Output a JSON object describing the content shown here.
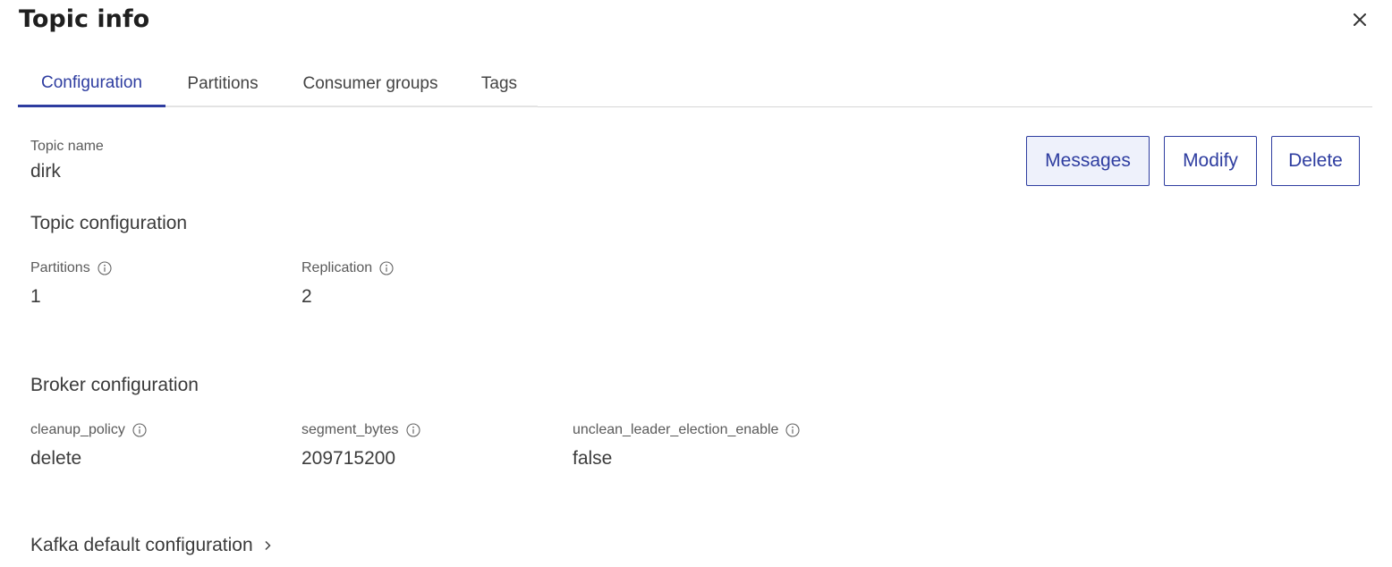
{
  "header": {
    "title": "Topic info"
  },
  "tabs": [
    {
      "label": "Configuration"
    },
    {
      "label": "Partitions"
    },
    {
      "label": "Consumer groups"
    },
    {
      "label": "Tags"
    }
  ],
  "topic": {
    "name_label": "Topic name",
    "name_value": "dirk"
  },
  "actions": {
    "messages": "Messages",
    "modify": "Modify",
    "delete": "Delete"
  },
  "topic_configuration": {
    "title": "Topic configuration",
    "fields": [
      {
        "label": "Partitions",
        "value": "1"
      },
      {
        "label": "Replication",
        "value": "2"
      }
    ]
  },
  "broker_configuration": {
    "title": "Broker configuration",
    "fields": [
      {
        "label": "cleanup_policy",
        "value": "delete"
      },
      {
        "label": "segment_bytes",
        "value": "209715200"
      },
      {
        "label": "unclean_leader_election_enable",
        "value": "false"
      }
    ]
  },
  "kafka_defaults": {
    "label": "Kafka default configuration"
  },
  "colors": {
    "accent": "#2e3da0",
    "primary_button_bg": "#eef1fb"
  },
  "icons": {
    "close": "close-icon",
    "info": "info-icon",
    "chevron": "chevron-right-icon"
  }
}
